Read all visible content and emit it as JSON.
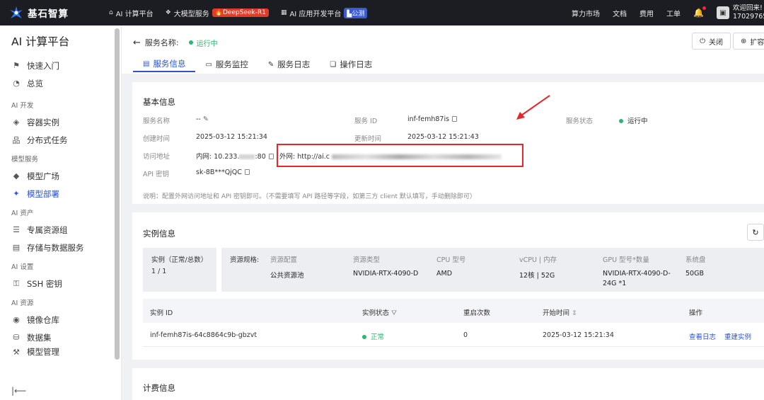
{
  "topbar": {
    "brand": "基石智算",
    "nav": [
      {
        "label": "AI 计算平台",
        "icon": "home-icon"
      },
      {
        "label": "大模型服务",
        "icon": "cube-icon",
        "badge": "DeepSeek-R1"
      },
      {
        "label": "AI 应用开发平台",
        "icon": "grid-icon",
        "badge": "公测"
      }
    ],
    "links": [
      "算力市场",
      "文档",
      "费用",
      "工单"
    ],
    "welcome_line1": "欢迎回来!",
    "welcome_line2": "17029765"
  },
  "sidebar": {
    "title": "AI 计算平台",
    "quick": [
      {
        "label": "快速入门",
        "icon": "signpost-icon"
      },
      {
        "label": "总览",
        "icon": "dashboard-icon"
      }
    ],
    "groups": [
      {
        "title": "AI 开发",
        "items": [
          {
            "label": "容器实例",
            "icon": "container-icon"
          },
          {
            "label": "分布式任务",
            "icon": "tree-icon"
          }
        ]
      },
      {
        "title": "模型服务",
        "items": [
          {
            "label": "模型广场",
            "icon": "layers-icon"
          },
          {
            "label": "模型部署",
            "icon": "deploy-icon",
            "active": true
          }
        ]
      },
      {
        "title": "AI 资产",
        "items": [
          {
            "label": "专属资源组",
            "icon": "server-icon"
          },
          {
            "label": "存储与数据服务",
            "icon": "storage-icon"
          }
        ]
      },
      {
        "title": "AI 设置",
        "items": [
          {
            "label": "SSH 密钥",
            "icon": "key-icon"
          }
        ]
      },
      {
        "title": "AI 资源",
        "items": [
          {
            "label": "镜像仓库",
            "icon": "image-repo-icon"
          },
          {
            "label": "数据集",
            "icon": "dataset-icon"
          },
          {
            "label": "模型管理",
            "icon": "model-icon"
          }
        ]
      }
    ]
  },
  "header": {
    "service_name_label": "服务名称:",
    "status": "运行中",
    "close_label": "关闭",
    "expand_label": "扩容",
    "tabs": [
      "服务信息",
      "服务监控",
      "服务日志",
      "操作日志"
    ]
  },
  "basic": {
    "title": "基本信息",
    "service_name_k": "服务名称",
    "service_name_v": "--",
    "service_id_k": "服务 ID",
    "service_id_v": "inf-femh87is",
    "service_status_k": "服务状态",
    "service_status_v": "运行中",
    "created_k": "创建时间",
    "created_v": "2025-03-12 15:21:34",
    "updated_k": "更新时间",
    "updated_v": "2025-03-12 15:21:43",
    "access_k": "访问地址",
    "internal_a": "内网: 10.233.",
    "internal_b": ":80",
    "external": "外网: http://ai.c",
    "api_k": "API 密钥",
    "api_v": "sk-8B***QjQC",
    "note": "说明：配置外网访问地址和 API 密钥即可。（不需要填写 API 路径等字段，如第三方 client 默认填写，手动删除即可）"
  },
  "instance": {
    "title": "实例信息",
    "count_label": "实例（正常/总数）",
    "count_value": "1 / 1",
    "spec_label": "资源规格:",
    "specs": [
      {
        "k": "资源配置",
        "v": "公共资源池"
      },
      {
        "k": "资源类型",
        "v": "NVIDIA-RTX-4090-D"
      },
      {
        "k": "CPU 型号",
        "v": "AMD"
      },
      {
        "k": "vCPU | 内存",
        "v": "12核 | 52G"
      },
      {
        "k": "GPU 型号*数量",
        "v": "NVIDIA-RTX-4090-D-",
        "v2": "24G *1"
      },
      {
        "k": "系统盘",
        "v": "50GB"
      }
    ],
    "columns": [
      "实例 ID",
      "实例状态",
      "重启次数",
      "开始时间",
      "操作"
    ],
    "row": {
      "id": "inf-femh87is-64c8864c9b-gbzvt",
      "status": "正常",
      "restarts": "0",
      "start": "2025-03-12 15:21:34",
      "op1": "查看日志",
      "op2": "重建实例"
    }
  },
  "billing": {
    "title": "计费信息"
  }
}
